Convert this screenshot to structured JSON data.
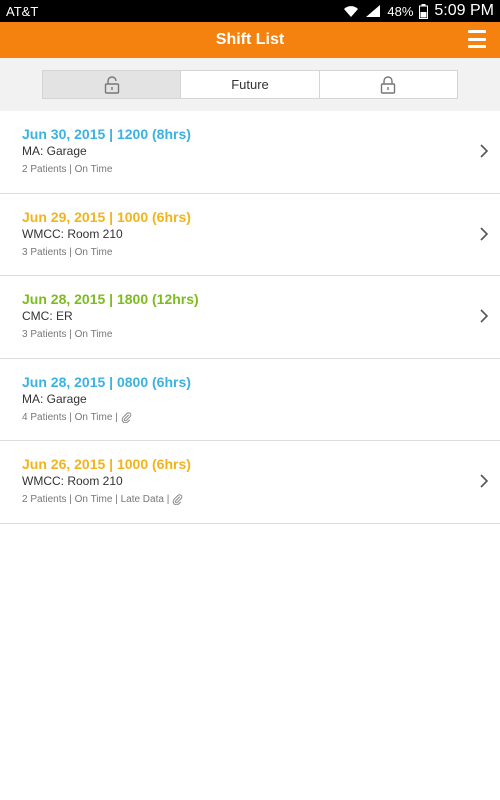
{
  "status": {
    "carrier": "AT&T",
    "battery": "48%",
    "time": "5:09 PM"
  },
  "header": {
    "title": "Shift List",
    "menu_icon": "hamburger-menu-icon"
  },
  "segments": {
    "unlocked_icon": "unlocked-lock-icon",
    "future_label": "Future",
    "locked_icon": "locked-lock-icon"
  },
  "colors": {
    "brand": "#f5820e",
    "blue": "#3cb2e0",
    "yellow": "#f2b41c",
    "green": "#7cbc1f"
  },
  "shifts": [
    {
      "date": "Jun 30, 2015 | 1200 (8hrs)",
      "location": "MA: Garage",
      "details": "2 Patients | On Time",
      "color": "#3cb2e0",
      "attachment": false,
      "chevron": true
    },
    {
      "date": "Jun 29, 2015 | 1000 (6hrs)",
      "location": "WMCC: Room 210",
      "details": "3 Patients | On Time",
      "color": "#f2b41c",
      "attachment": false,
      "chevron": true
    },
    {
      "date": "Jun 28, 2015 | 1800 (12hrs)",
      "location": "CMC: ER",
      "details": "3 Patients | On Time",
      "color": "#7cbc1f",
      "attachment": false,
      "chevron": true
    },
    {
      "date": "Jun 28, 2015 | 0800 (6hrs)",
      "location": "MA: Garage",
      "details": "4 Patients | On Time |",
      "color": "#3cb2e0",
      "attachment": true,
      "chevron": false
    },
    {
      "date": "Jun 26, 2015 | 1000 (6hrs)",
      "location": "WMCC: Room 210",
      "details": "2 Patients | On Time | Late Data |",
      "color": "#f2b41c",
      "attachment": true,
      "chevron": true
    }
  ]
}
